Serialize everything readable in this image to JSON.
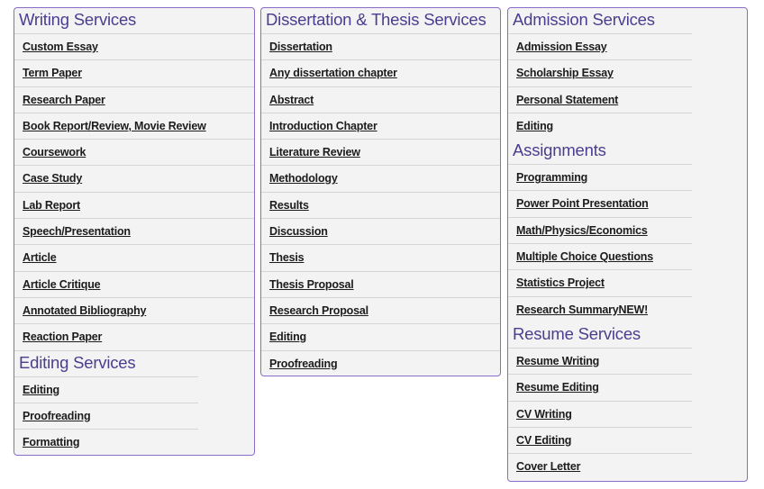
{
  "columns": [
    {
      "sections": [
        {
          "title": "Writing Services",
          "items": [
            "Custom Essay",
            "Term Paper",
            "Research Paper",
            "Book Report/Review, Movie Review",
            "Coursework",
            "Case Study",
            "Lab Report",
            "Speech/Presentation",
            "Article",
            "Article Critique",
            "Annotated Bibliography",
            "Reaction Paper"
          ]
        },
        {
          "title": "Editing Services",
          "items": [
            "Editing",
            "Proofreading",
            "Formatting"
          ]
        }
      ]
    },
    {
      "sections": [
        {
          "title": "Dissertation & Thesis Services",
          "items": [
            "Dissertation",
            "Any dissertation chapter",
            "Abstract",
            "Introduction Chapter",
            "Literature Review",
            "Methodology",
            "Results",
            "Discussion",
            "Thesis",
            "Thesis Proposal",
            "Research Proposal",
            "Editing",
            "Proofreading"
          ]
        }
      ]
    },
    {
      "sections": [
        {
          "title": "Admission Services",
          "items": [
            "Admission Essay",
            "Scholarship Essay",
            "Personal Statement",
            "Editing"
          ]
        },
        {
          "title": "Assignments",
          "items": [
            "Programming",
            "Power Point Presentation",
            "Math/Physics/Economics",
            "Multiple Choice Questions",
            "Statistics Project",
            "Research SummaryNEW!"
          ]
        },
        {
          "title": "Resume Services",
          "items": [
            "Resume Writing",
            "Resume Editing",
            "CV Writing",
            "CV Editing",
            "Cover Letter"
          ]
        }
      ]
    }
  ],
  "colors": {
    "heading": "#4a3e8f",
    "border": "#8a6cc8",
    "panel": "#f3f3f3"
  }
}
